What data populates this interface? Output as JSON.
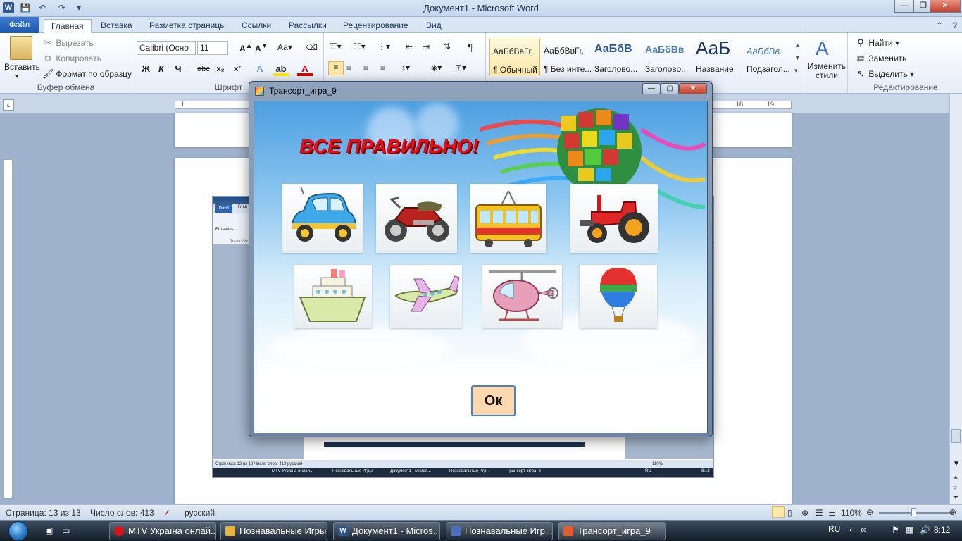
{
  "window": {
    "title": "Документ1 - Microsoft Word",
    "app_letter": "W",
    "controls": {
      "minimize": "—",
      "maximize": "❐",
      "close": "✕"
    }
  },
  "ribbon": {
    "tabs": [
      {
        "label": "Файл"
      },
      {
        "label": "Главная"
      },
      {
        "label": "Вставка"
      },
      {
        "label": "Разметка страницы"
      },
      {
        "label": "Ссылки"
      },
      {
        "label": "Рассылки"
      },
      {
        "label": "Рецензирование"
      },
      {
        "label": "Вид"
      }
    ],
    "clipboard": {
      "paste": "Вставить",
      "cut": "Вырезать",
      "copy": "Копировать",
      "format_painter": "Формат по образцу",
      "group_label": "Буфер обмена"
    },
    "font": {
      "name": "Calibri (Осно",
      "size": "11",
      "bold": "Ж",
      "italic": "К",
      "underline": "Ч",
      "strike": "abc",
      "group_label": "Шрифт"
    },
    "styles": [
      {
        "preview": "АаБбВвГг,",
        "name": "¶ Обычный"
      },
      {
        "preview": "АаБбВвГг,",
        "name": "¶ Без инте..."
      },
      {
        "preview": "АаБбВ",
        "name": "Заголово..."
      },
      {
        "preview": "АаБбВв",
        "name": "Заголово..."
      },
      {
        "preview": "АаБ",
        "name": "Название"
      },
      {
        "preview": "АаБбВв.",
        "name": "Подзагол..."
      }
    ],
    "change_styles": "Изменить стили",
    "editing": {
      "find": "Найти",
      "replace": "Заменить",
      "select": "Выделить",
      "group_label": "Редактирование"
    }
  },
  "ruler": {
    "ticks": [
      "1",
      "18",
      "19"
    ]
  },
  "nested": {
    "status": "Страница: 12 из 12   Число слов: 413   русский",
    "tab_file": "Файл",
    "tab_home": "Глав",
    "paste": "Вставить",
    "clipboard_short": "Буфер обм",
    "taskbar": [
      "MTV Україна онлай...",
      "Познавальные Игры",
      "Документ1 - Micros...",
      "Познавальные Игр...",
      "Трансорт_игра_8"
    ],
    "tray_time": "8:12",
    "tray_lang": "RU",
    "zoom": "110%"
  },
  "statusbar": {
    "page": "Страница: 13 из 13",
    "words": "Число слов: 413",
    "language": "русский",
    "zoom": "110%"
  },
  "taskbar": {
    "items": [
      {
        "label": "MTV Україна онлай...",
        "icon": "opera-icon",
        "color": "#d8141b"
      },
      {
        "label": "Познавальные Игры",
        "icon": "folder-icon",
        "color": "#e8b53c"
      },
      {
        "label": "Документ1 - Micros...",
        "icon": "word-icon",
        "color": "#2b5797"
      },
      {
        "label": "Познавальные Игр...",
        "icon": "app-icon",
        "color": "#4b6fbf"
      },
      {
        "label": "Трансорт_игра_9",
        "icon": "game-icon",
        "color": "#e55b2b"
      }
    ],
    "lang": "RU",
    "time": "8:12"
  },
  "dialog": {
    "title": "Трансорт_игра_9",
    "banner": "ВСЕ ПРАВИЛЬНО!",
    "ok_label": "Ок",
    "tiles": [
      {
        "name": "car-tile",
        "icon": "car-icon"
      },
      {
        "name": "motorcycle-tile",
        "icon": "motorcycle-icon"
      },
      {
        "name": "tram-tile",
        "icon": "tram-icon"
      },
      {
        "name": "tractor-tile",
        "icon": "tractor-icon"
      },
      {
        "name": "ship-tile",
        "icon": "ship-icon"
      },
      {
        "name": "airplane-tile",
        "icon": "airplane-icon"
      },
      {
        "name": "helicopter-tile",
        "icon": "helicopter-icon"
      },
      {
        "name": "balloon-tile",
        "icon": "hot-air-balloon-icon"
      }
    ],
    "colors": {
      "banner": "#e1101a",
      "ok_bg": "#ffd8b0",
      "ok_border": "#3b87c9"
    }
  }
}
